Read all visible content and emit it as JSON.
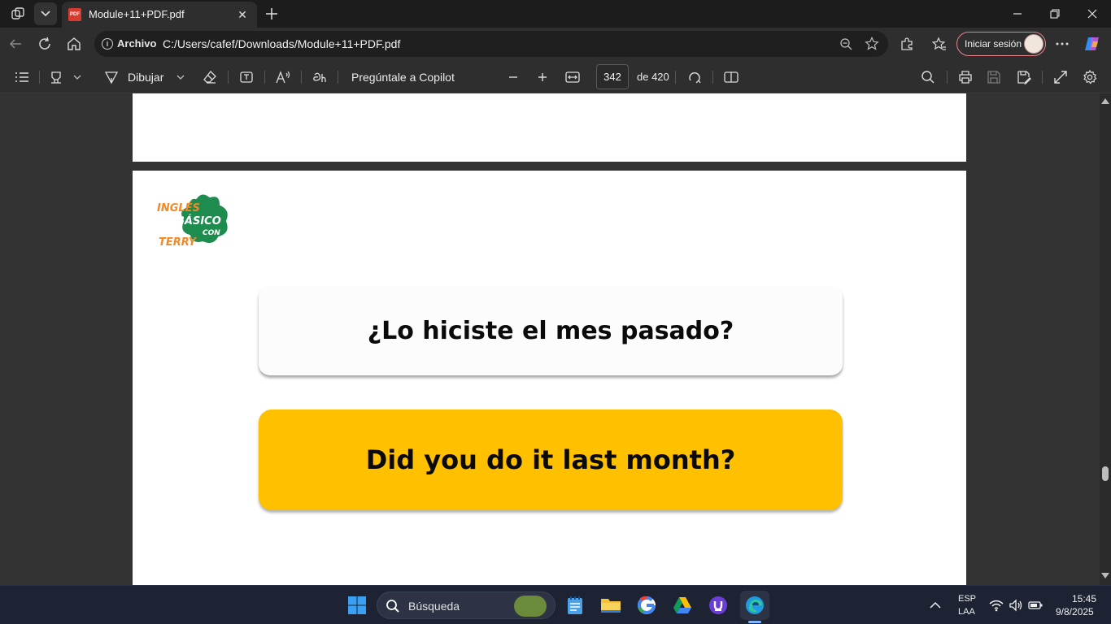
{
  "browser": {
    "tab": {
      "title": "Module+11+PDF.pdf",
      "icon_text": "PDF",
      "close": "✕"
    },
    "address": {
      "scheme_label": "Archivo",
      "url": "C:/Users/cafef/Downloads/Module+11+PDF.pdf"
    },
    "signin_label": "Iniciar sesión"
  },
  "pdf_toolbar": {
    "draw_label": "Dibujar",
    "copilot_label": "Pregúntale a Copilot",
    "page_current": "342",
    "page_total_label": "de 420"
  },
  "page": {
    "logo": {
      "line1": "INGLÉS",
      "line2": "BÁSICO",
      "line3": "CON",
      "line4": "TERRY"
    },
    "question": "¿Lo hiciste el mes pasado?",
    "answer": "Did you do it last month?"
  },
  "taskbar": {
    "search_placeholder": "Búsqueda",
    "lang_line1": "ESP",
    "lang_line2": "LAA",
    "time": "15:45",
    "date": "9/8/2025"
  },
  "colors": {
    "answer_card": "#ffc000",
    "logo_green": "#1e8c4e",
    "logo_orange": "#f08a28",
    "signin_border": "#e6848c"
  }
}
